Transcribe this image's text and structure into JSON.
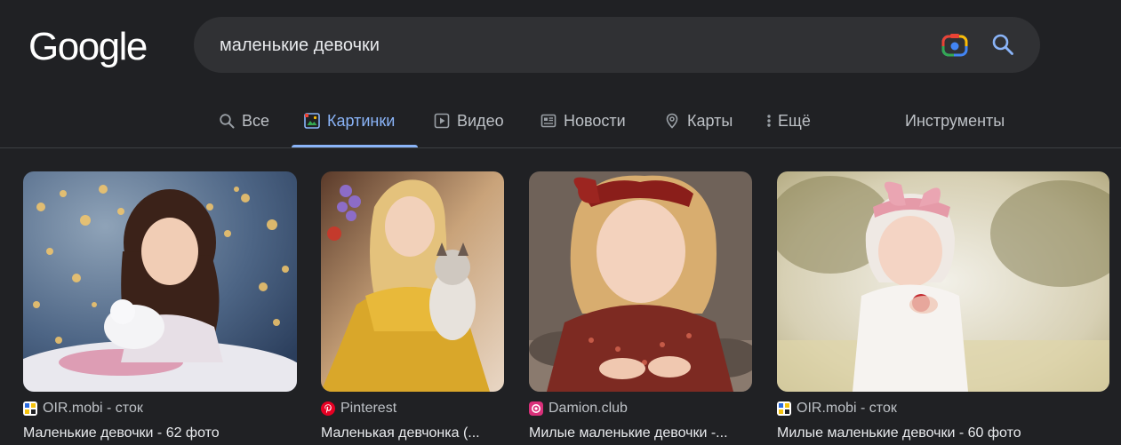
{
  "logo": {
    "text": "Google"
  },
  "search": {
    "query": "маленькие девочки",
    "lens_icon": "google-lens-icon",
    "search_icon": "search-icon"
  },
  "tabs": [
    {
      "label": "Все",
      "icon": "search-icon",
      "active": false
    },
    {
      "label": "Картинки",
      "icon": "images-icon",
      "active": true
    },
    {
      "label": "Видео",
      "icon": "video-play-icon",
      "active": false
    },
    {
      "label": "Новости",
      "icon": "news-icon",
      "active": false
    },
    {
      "label": "Карты",
      "icon": "map-pin-icon",
      "active": false
    },
    {
      "label": "Ещё",
      "icon": "more-vert-icon",
      "active": false
    }
  ],
  "tools": {
    "label": "Инструменты"
  },
  "results": [
    {
      "source": "OIR.mobi - сток",
      "title": "Маленькие девочки - 62 фото",
      "favicon": "oir-favicon"
    },
    {
      "source": "Pinterest",
      "title": "Маленькая девчонка (...",
      "favicon": "pinterest-favicon"
    },
    {
      "source": "Damion.club",
      "title": "Милые маленькие девочки -...",
      "favicon": "damion-favicon"
    },
    {
      "source": "OIR.mobi - сток",
      "title": "Милые маленькие девочки - 60 фото",
      "favicon": "oir-favicon"
    }
  ],
  "colors": {
    "background": "#202124",
    "search_bg": "#303134",
    "accent": "#8ab4f8",
    "muted_text": "#bdc1c6",
    "text": "#e8eaed"
  }
}
